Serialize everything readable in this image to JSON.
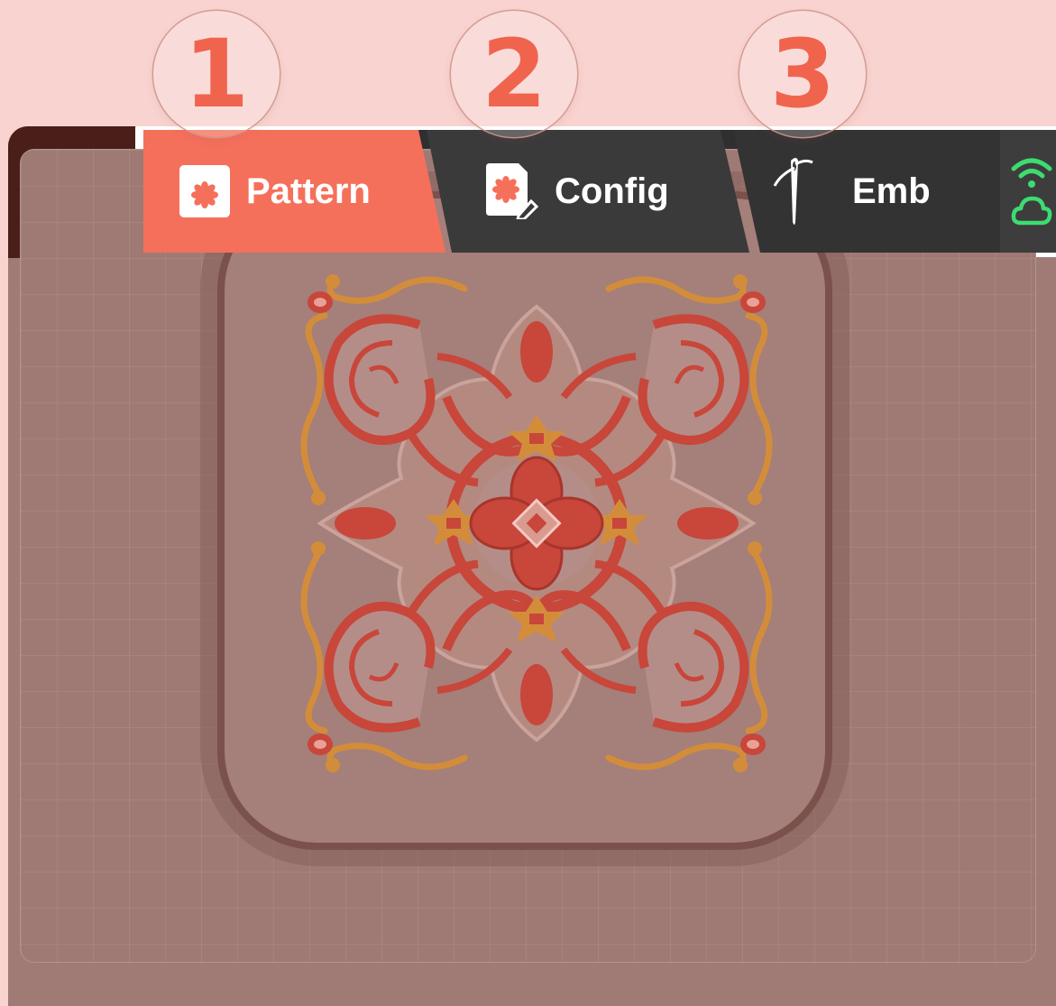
{
  "step_badges": [
    "1",
    "2",
    "3"
  ],
  "apps_button": {
    "icon": "apps-grid-icon"
  },
  "tabs": [
    {
      "label": "Pattern",
      "icon": "pattern-file-icon",
      "active": true
    },
    {
      "label": "Config",
      "icon": "config-edit-icon",
      "active": false
    },
    {
      "label": "Emb",
      "icon": "needle-icon",
      "active": false
    }
  ],
  "status": {
    "wifi_icon": "wifi-icon",
    "cloud_icon": "cloud-icon",
    "color": "#3ddc71"
  },
  "colors": {
    "accent": "#f5705b",
    "tab_dark": "#333333",
    "apps_tile": "#4a1f19",
    "canvas": "#9f7a74",
    "thread_red": "#c8463a",
    "thread_gold": "#d38d3a"
  }
}
